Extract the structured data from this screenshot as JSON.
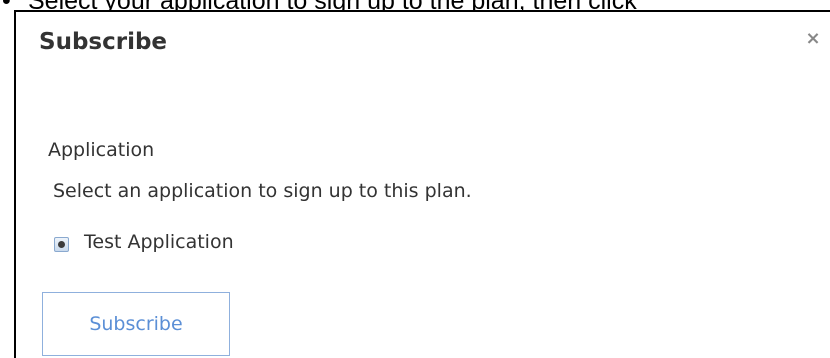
{
  "background_text": {
    "bullet": "•",
    "instruction": "Select your application to sign up to the plan, then click"
  },
  "dialog": {
    "title": "Subscribe",
    "close_glyph": "×",
    "section_label": "Application",
    "section_help": "Select an application to sign up to this plan.",
    "applications": [
      {
        "label": "Test Application",
        "selected": true
      }
    ],
    "submit_label": "Subscribe"
  },
  "colors": {
    "button_text": "#5b8fd6",
    "button_border": "#8fb0dd",
    "text": "#333333"
  }
}
